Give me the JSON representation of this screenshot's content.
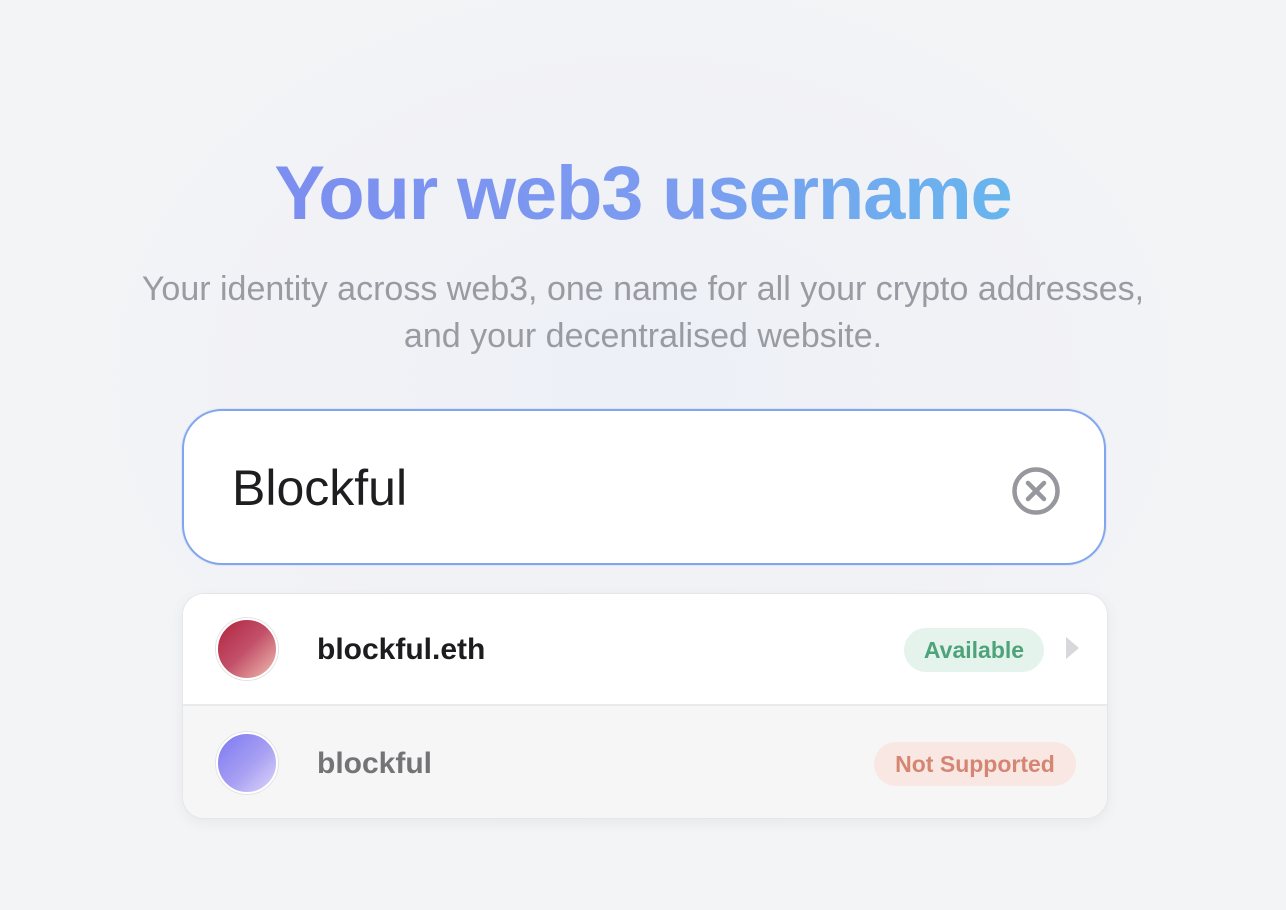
{
  "hero": {
    "title": "Your web3 username",
    "subtitle_line1": "Your identity across web3, one name for all your crypto addresses,",
    "subtitle_line2": "and your decentralised website."
  },
  "search": {
    "value": "Blockful",
    "clear_icon": "close-circle-icon"
  },
  "results": [
    {
      "name": "blockful.eth",
      "status": "Available",
      "status_color": "#4ea37a",
      "status_bg": "#e4f3ec",
      "icon": "chevron-right-icon"
    },
    {
      "name": "blockful",
      "status": "Not Supported",
      "status_color": "#d48673",
      "status_bg": "#f9e7e3"
    }
  ],
  "colors": {
    "title_gradient_start": "#7c8ef0",
    "title_gradient_end": "#67b6ee",
    "focus_border": "#82a6ee"
  }
}
